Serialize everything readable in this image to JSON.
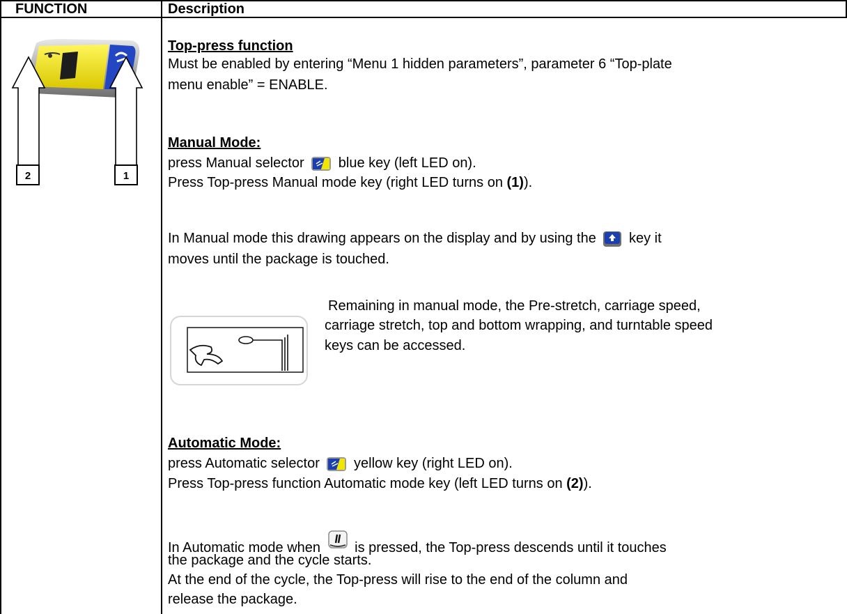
{
  "table": {
    "header": {
      "function": "FUNCTION",
      "description": "Description"
    }
  },
  "left": {
    "callout_2": "2",
    "callout_1": "1"
  },
  "content": {
    "title": "Top-press function",
    "intro_line1": "Must be enabled by entering “Menu 1 hidden parameters”, parameter 6 “Top-plate",
    "intro_line2": "menu enable” = ENABLE.",
    "manual_heading": "Manual Mode:",
    "manual_l1a": "press Manual selector",
    "manual_l1b": "blue key (left LED on).",
    "manual_l2a": "Press Top-press Manual mode key (right LED turns on ",
    "manual_l2b": "(1)",
    "manual_l2c": ").",
    "manual_l3a": "In Manual mode this drawing appears on the display and by using the",
    "manual_l3b": "key it",
    "manual_l4": "moves until the package is touched.",
    "remain_l1": "Remaining in manual mode, the Pre-stretch, carriage speed,",
    "remain_l2": "carriage stretch, top and bottom wrapping, and turntable speed",
    "remain_l3": "keys can be accessed.",
    "auto_heading": "Automatic Mode:",
    "auto_l1a": "press Automatic selector",
    "auto_l1b": "yellow key (right LED on).",
    "auto_l2a": "Press Top-press function Automatic mode key (left LED turns on ",
    "auto_l2b": "(2)",
    "auto_l2c": ").",
    "auto_l3a": "In Automatic mode when",
    "auto_l3b": "is pressed, the Top-press descends until it touches",
    "auto_l4": "the package and the cycle starts.",
    "auto_l5": "At the end of the cycle, the Top-press will rise to the end of the column and",
    "auto_l6": "release the package."
  },
  "colors": {
    "key_yellow": "#f2e500",
    "key_blue": "#1c3fb0",
    "border": "#000000"
  },
  "icons": [
    "selector-key-icon",
    "up-arrow-key-icon",
    "start-key-icon",
    "top-press-key-icon",
    "display-drawing-icon"
  ]
}
